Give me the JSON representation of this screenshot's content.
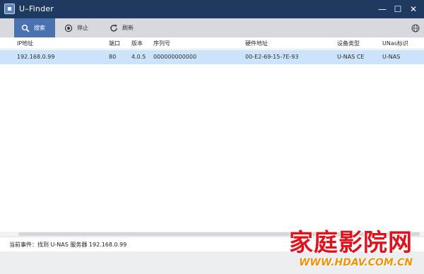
{
  "window": {
    "title": "U–Finder",
    "controls": {
      "minimize": "—",
      "maximize": "☐",
      "close": "✕"
    }
  },
  "toolbar": {
    "search_label": "搜索",
    "stop_label": "停止",
    "refresh_label": "刷新",
    "icons": [
      "search-icon",
      "stop-icon",
      "refresh-icon",
      "globe-icon"
    ]
  },
  "table": {
    "columns": [
      "IP地址",
      "端口",
      "版本",
      "序列号",
      "硬件地址",
      "设备类型",
      "UNas标识"
    ],
    "rows": [
      [
        "192.168.0.99",
        "80",
        "4.0.5",
        "000000000000",
        "00-E2-69-15-7E-93",
        "U-NAS CE",
        "U-NAS"
      ]
    ]
  },
  "status": {
    "text": "当前事件：找到 U-NAS 服务器 192.168.0.99"
  },
  "watermark": {
    "main": "家庭影院网",
    "url": "WWW.HDAV.COM.CN"
  },
  "colors": {
    "titlebar": "#1f3a61",
    "toolbar": "#d6d9de",
    "active_button": "#4a72b0",
    "selected_row": "#cce4fb",
    "watermark_red": "#e1121b",
    "watermark_orange": "#f2920a"
  }
}
